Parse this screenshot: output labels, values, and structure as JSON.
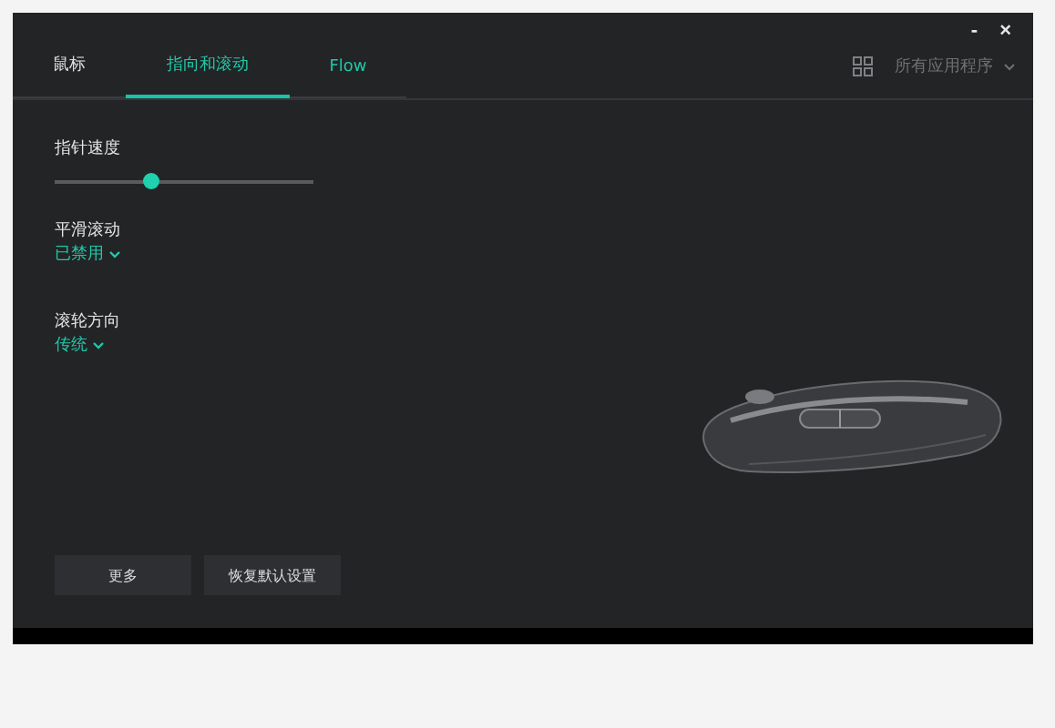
{
  "window_controls": {
    "minimize": "-",
    "close": "×"
  },
  "tabs": [
    {
      "label": "鼠标",
      "selected": false
    },
    {
      "label": "指向和滚动",
      "selected": true
    },
    {
      "label": "Flow",
      "selected": false
    }
  ],
  "app_selector": {
    "label": "所有应用程序"
  },
  "pointer_speed": {
    "label": "指针速度",
    "level": 0.37
  },
  "settings": [
    {
      "label": "平滑滚动",
      "value": "已禁用"
    },
    {
      "label": "滚轮方向",
      "value": "传统"
    }
  ],
  "buttons": [
    "更多",
    "恢复默认设置"
  ]
}
